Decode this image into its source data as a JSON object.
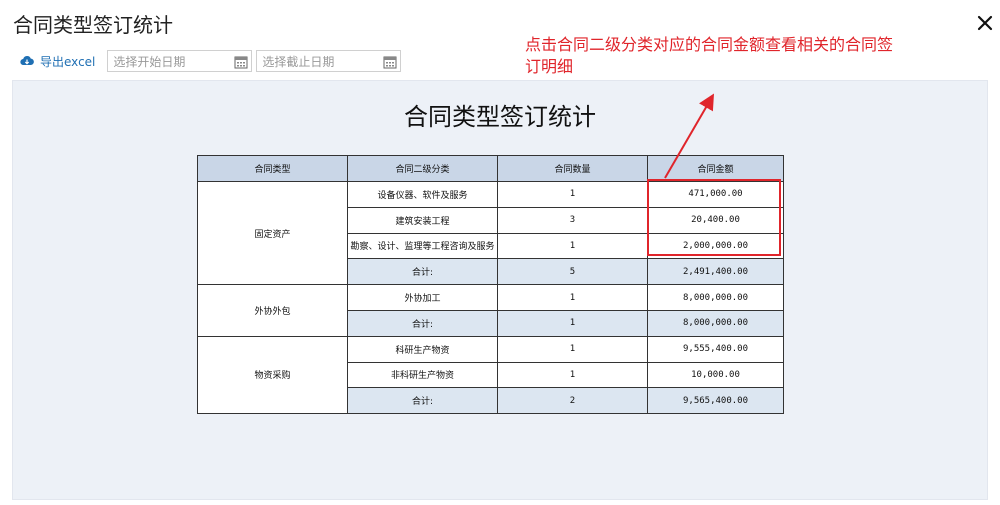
{
  "dialog": {
    "title": "合同类型签订统计"
  },
  "toolbar": {
    "export_label": "导出excel",
    "start_date_placeholder": "选择开始日期",
    "end_date_placeholder": "选择截止日期"
  },
  "annotation": {
    "note": "点击合同二级分类对应的合同金额查看相关的合同签订明细",
    "color": "#e0252b"
  },
  "report": {
    "title": "合同类型签订统计",
    "headers": [
      "合同类型",
      "合同二级分类",
      "合同数量",
      "合同金额"
    ],
    "groups": [
      {
        "type": "固定资产",
        "rows": [
          {
            "category": "设备仪器、软件及服务",
            "count": "1",
            "amount": "471,000.00"
          },
          {
            "category": "建筑安装工程",
            "count": "3",
            "amount": "20,400.00"
          },
          {
            "category": "勘察、设计、监理等工程咨询及服务",
            "count": "1",
            "amount": "2,000,000.00"
          }
        ],
        "subtotal": {
          "label": "合计:",
          "count": "5",
          "amount": "2,491,400.00"
        }
      },
      {
        "type": "外协外包",
        "rows": [
          {
            "category": "外协加工",
            "count": "1",
            "amount": "8,000,000.00"
          }
        ],
        "subtotal": {
          "label": "合计:",
          "count": "1",
          "amount": "8,000,000.00"
        }
      },
      {
        "type": "物资采购",
        "rows": [
          {
            "category": "科研生产物资",
            "count": "1",
            "amount": "9,555,400.00"
          },
          {
            "category": "非科研生产物资",
            "count": "1",
            "amount": "10,000.00"
          }
        ],
        "subtotal": {
          "label": "合计:",
          "count": "2",
          "amount": "9,565,400.00"
        }
      }
    ]
  },
  "colors": {
    "header_bg": "#c9d6e7",
    "subtotal_bg": "#dce6f1",
    "panel_bg": "#edf1f7",
    "link": "#1f6fb3"
  }
}
